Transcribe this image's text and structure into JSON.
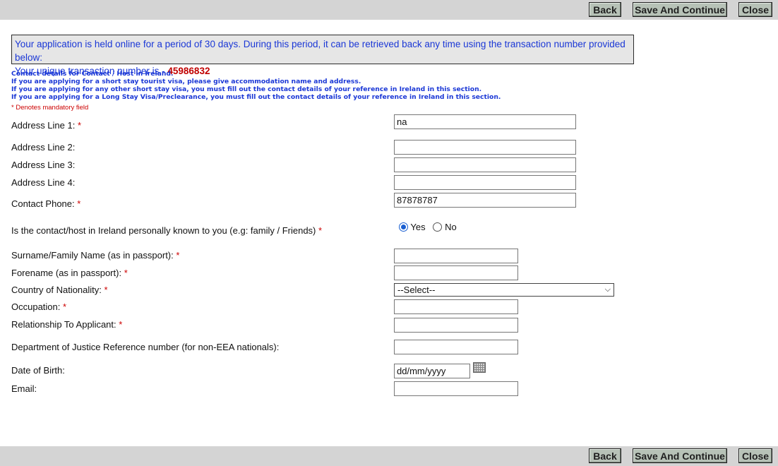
{
  "buttons": {
    "back": "Back",
    "save": "Save And Continue",
    "close": "Close"
  },
  "info": {
    "line1": "Your application is held online for a period of 30 days. During this period, it can be retrieved back any time using the transaction number provided below:",
    "line2_prefix": "Your unique transaction number is - ",
    "transaction_number": "45986832"
  },
  "notes": [
    "Contact details for Contact / Host in Ireland.",
    "If you are applying for a short stay tourist visa, please give accommodation name and address.",
    "If you are applying for any other short stay visa, you must fill out the contact details of your reference in Ireland in this section.",
    "If you are applying for a Long Stay Visa/Preclearance, you must fill out the contact details of your reference in Ireland in this section."
  ],
  "mandatory_note": "* Denotes mandatory field",
  "form": {
    "address1": {
      "label": "Address Line 1:",
      "required": "*",
      "value": "na"
    },
    "address2": {
      "label": "Address Line 2:",
      "value": ""
    },
    "address3": {
      "label": "Address Line 3:",
      "value": ""
    },
    "address4": {
      "label": "Address Line 4:",
      "value": ""
    },
    "phone": {
      "label": "Contact Phone:",
      "required": "*",
      "value": "87878787"
    },
    "known": {
      "label": "Is the contact/host in Ireland personally known to you (e.g: family / Friends)",
      "required": "*",
      "yes": "Yes",
      "no": "No",
      "selected": "Yes"
    },
    "surname": {
      "label": "Surname/Family Name (as in passport):",
      "required": "*",
      "value": ""
    },
    "forename": {
      "label": "Forename (as in passport):",
      "required": "*",
      "value": ""
    },
    "nationality": {
      "label": "Country of Nationality:",
      "required": "*",
      "selected": "--Select--"
    },
    "occupation": {
      "label": "Occupation:",
      "required": "*",
      "value": ""
    },
    "relationship": {
      "label": "Relationship To Applicant:",
      "required": "*",
      "value": ""
    },
    "doj": {
      "label": "Department of Justice Reference number (for non-EEA nationals):",
      "value": ""
    },
    "dob": {
      "label": "Date of Birth:",
      "value": "dd/mm/yyyy"
    },
    "email": {
      "label": "Email:",
      "value": ""
    }
  },
  "colors": {
    "info_text": "#1a37d6",
    "required": "#cc0000",
    "bar": "#d4d4d4",
    "button": "#b7c2b7"
  }
}
